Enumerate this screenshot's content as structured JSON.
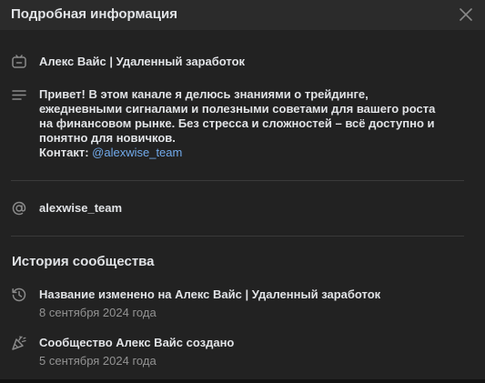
{
  "dialog": {
    "title": "Подробная информация"
  },
  "community": {
    "name": "Алекс Вайс | Удаленный заработок",
    "description": "Привет! В этом канале я делюсь знаниями о трейдинге, ежедневными сигналами и полезными советами для вашего роста на финансовом рынке. Без стресса и сложностей – всё доступно и понятно для новичков.",
    "contact_label": "Контакт:",
    "contact_link": "@alexwise_team",
    "address": "alexwise_team"
  },
  "history": {
    "title": "История сообщества",
    "events": [
      {
        "text": "Название изменено на Алекс Вайс | Удаленный заработок",
        "date": "8 сентября 2024 года"
      },
      {
        "text": "Сообщество Алекс Вайс создано",
        "date": "5 сентября 2024 года"
      }
    ]
  }
}
